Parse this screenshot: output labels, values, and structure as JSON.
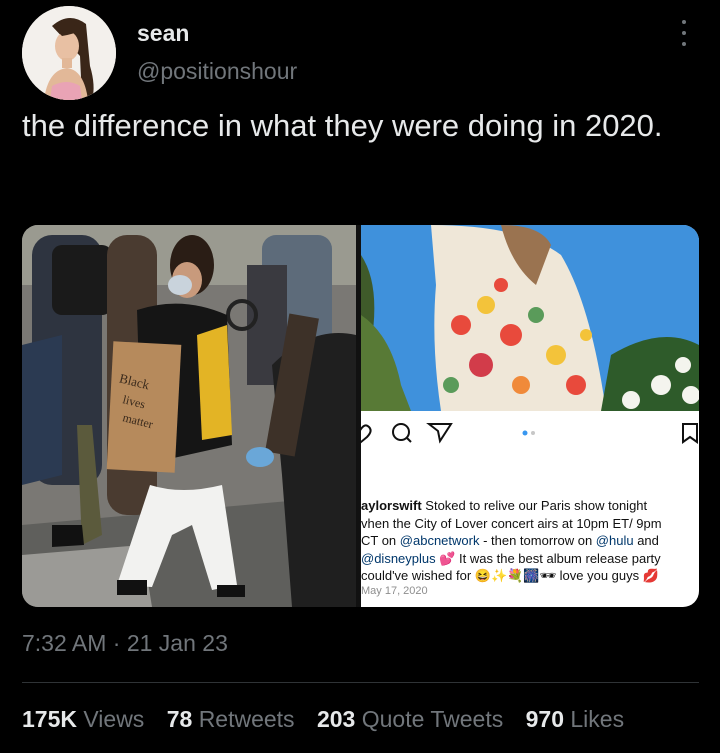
{
  "author": {
    "display_name": "sean",
    "handle": "@positionshour",
    "avatar_icon": "avatar-photo"
  },
  "tweet": {
    "text": "the difference in what they were doing in 2020.",
    "timestamp": "7:32 AM · 21 Jan 23"
  },
  "media": {
    "left_photo": {
      "sign_text": "Black lives matter"
    },
    "right_screenshot": {
      "caption_user": "aylorswift",
      "caption_lines": [
        " Stoked to relive our Paris show tonight",
        "vhen the City of Lover concert airs at 10pm ET/ 9pm",
        "CT on ",
        " - then tomorrow on ",
        " and"
      ],
      "mentions": [
        "@abcnetwork",
        "@hulu",
        "@disneyplus"
      ],
      "caption_line4_rest": " 💕 It was the best album release party",
      "caption_line5": "could've wished for 😆✨💐🎆🕶 love you guys 💋",
      "date": "May 17, 2020"
    }
  },
  "stats": {
    "views_count": "175K",
    "views_label": "Views",
    "retweets_count": "78",
    "retweets_label": "Retweets",
    "quotes_count": "203",
    "quotes_label": "Quote Tweets",
    "likes_count": "970",
    "likes_label": "Likes"
  },
  "colors": {
    "background": "#000000",
    "primary_text": "#e7e9ea",
    "secondary_text": "#71767b",
    "divider": "#2f3336"
  }
}
